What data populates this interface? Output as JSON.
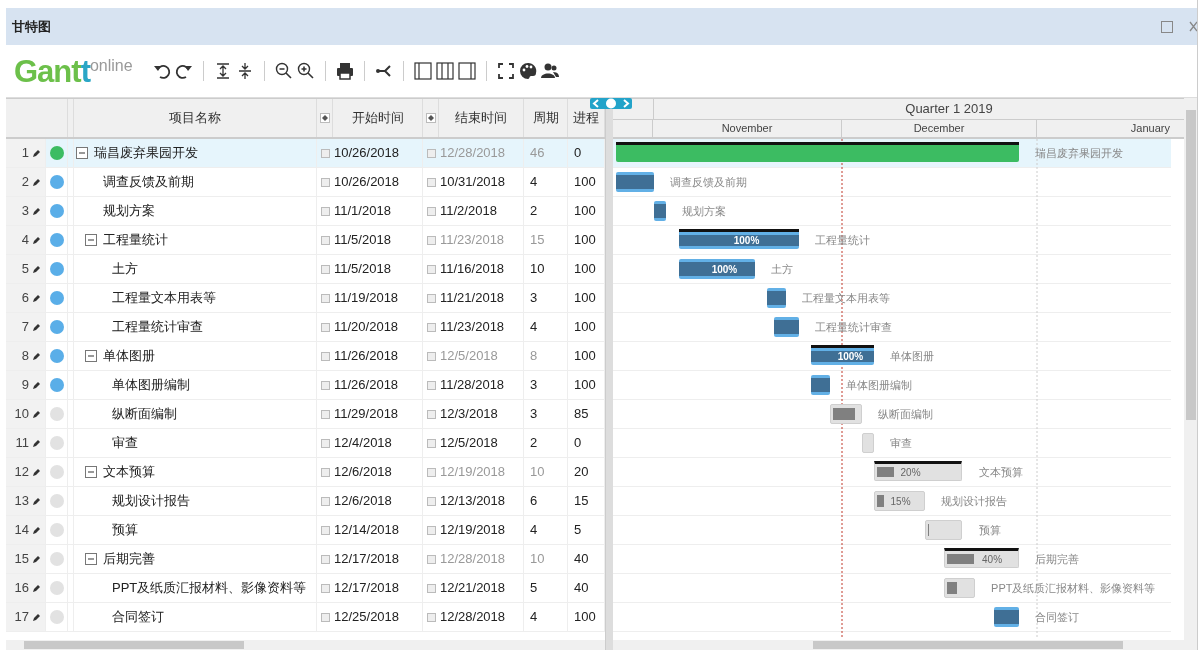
{
  "window": {
    "title": "甘特图"
  },
  "toolbar": {
    "logo": {
      "main": "Gant",
      "accent": "t",
      "suffix": "online"
    }
  },
  "grid": {
    "columns": [
      "项目名称",
      "开始时间",
      "结束时间",
      "周期",
      "进程"
    ],
    "rows": [
      {
        "number": "1",
        "color": "#3cbc62",
        "name": "瑞昌废弃果园开发",
        "expanded": true,
        "selected": true,
        "start": "10/26/2018",
        "end": "12/28/2018",
        "duration": "46",
        "progress": "0",
        "bar": {
          "kind": "project",
          "caption": "瑞昌废弃果园开发"
        },
        "children": [
          {
            "number": "2",
            "color": "#5aaee8",
            "name": "调查反馈及前期",
            "selected": false,
            "start": "10/26/2018",
            "end": "10/31/2018",
            "duration": "4",
            "progress": "100",
            "bar": {
              "kind": "task",
              "caption": "调查反馈及前期"
            }
          },
          {
            "number": "3",
            "color": "#5aaee8",
            "name": "规划方案",
            "selected": false,
            "start": "11/1/2018",
            "end": "11/2/2018",
            "duration": "2",
            "progress": "100",
            "bar": {
              "kind": "task",
              "caption": "规划方案"
            }
          },
          {
            "number": "4",
            "color": "#5aaee8",
            "name": "工程量统计",
            "expanded": true,
            "selected": false,
            "start": "11/5/2018",
            "end": "11/23/2018",
            "duration": "15",
            "progress": "100",
            "bar": {
              "kind": "task",
              "label": "100%",
              "caption": "工程量统计"
            },
            "children": [
              {
                "number": "5",
                "color": "#5aaee8",
                "name": "土方",
                "selected": false,
                "start": "11/5/2018",
                "end": "11/16/2018",
                "duration": "10",
                "progress": "100",
                "bar": {
                  "kind": "task",
                  "label": "100%",
                  "caption": "土方"
                }
              },
              {
                "number": "6",
                "color": "#5aaee8",
                "name": "工程量文本用表等",
                "selected": false,
                "start": "11/19/2018",
                "end": "11/21/2018",
                "duration": "3",
                "progress": "100",
                "bar": {
                  "kind": "task",
                  "caption": "工程量文本用表等"
                }
              },
              {
                "number": "7",
                "color": "#5aaee8",
                "name": "工程量统计审查",
                "selected": false,
                "start": "11/20/2018",
                "end": "11/23/2018",
                "duration": "4",
                "progress": "100",
                "bar": {
                  "kind": "task",
                  "caption": "工程量统计审查"
                }
              }
            ]
          },
          {
            "number": "8",
            "color": "#5aaee8",
            "name": "单体图册",
            "expanded": true,
            "selected": false,
            "start": "11/26/2018",
            "end": "12/5/2018",
            "duration": "8",
            "progress": "100",
            "bar": {
              "kind": "task",
              "label": "100%",
              "caption": "单体图册"
            },
            "children": [
              {
                "number": "9",
                "color": "#5aaee8",
                "name": "单体图册编制",
                "selected": false,
                "start": "11/26/2018",
                "end": "11/28/2018",
                "duration": "3",
                "progress": "100",
                "bar": {
                  "kind": "task",
                  "caption": "单体图册编制"
                }
              },
              {
                "number": "10",
                "color": "#e2e2e2",
                "name": "纵断面编制",
                "selected": false,
                "start": "11/29/2018",
                "end": "12/3/2018",
                "duration": "3",
                "progress": "85",
                "bar": {
                  "kind": "task",
                  "caption": "纵断面编制"
                }
              },
              {
                "number": "11",
                "color": "#e2e2e2",
                "name": "审查",
                "selected": false,
                "start": "12/4/2018",
                "end": "12/5/2018",
                "duration": "2",
                "progress": "0",
                "bar": {
                  "kind": "task",
                  "caption": "审查"
                }
              }
            ]
          },
          {
            "number": "12",
            "color": "#e2e2e2",
            "name": "文本预算",
            "expanded": true,
            "selected": false,
            "start": "12/6/2018",
            "end": "12/19/2018",
            "duration": "10",
            "progress": "20",
            "bar": {
              "kind": "task",
              "label": "20%",
              "caption": "文本预算"
            },
            "children": [
              {
                "number": "13",
                "color": "#e2e2e2",
                "name": "规划设计报告",
                "selected": false,
                "start": "12/6/2018",
                "end": "12/13/2018",
                "duration": "6",
                "progress": "15",
                "bar": {
                  "kind": "task",
                  "label": "15%",
                  "caption": "规划设计报告"
                }
              },
              {
                "number": "14",
                "color": "#e2e2e2",
                "name": "预算",
                "selected": false,
                "start": "12/14/2018",
                "end": "12/19/2018",
                "duration": "4",
                "progress": "5",
                "bar": {
                  "kind": "task",
                  "caption": "预算"
                }
              }
            ]
          },
          {
            "number": "15",
            "color": "#e2e2e2",
            "name": "后期完善",
            "expanded": true,
            "selected": false,
            "start": "12/17/2018",
            "end": "12/28/2018",
            "duration": "10",
            "progress": "40",
            "bar": {
              "kind": "task",
              "label": "40%",
              "caption": "后期完善"
            },
            "children": [
              {
                "number": "16",
                "color": "#e2e2e2",
                "name": "PPT及纸质汇报材料、影像资料等",
                "selected": false,
                "start": "12/17/2018",
                "end": "12/21/2018",
                "duration": "5",
                "progress": "40",
                "bar": {
                  "kind": "task",
                  "caption": "PPT及纸质汇报材料、影像资料等"
                }
              },
              {
                "number": "17",
                "color": "#e2e2e2",
                "name": "合同签订",
                "selected": false,
                "start": "12/25/2018",
                "end": "12/28/2018",
                "duration": "4",
                "progress": "100",
                "bar": {
                  "kind": "task",
                  "caption": "合同签订"
                }
              }
            ]
          }
        ]
      }
    ]
  },
  "timeline": {
    "quarter": "Quarter 1 2019",
    "months": [
      "November",
      "December",
      "January"
    ]
  }
}
